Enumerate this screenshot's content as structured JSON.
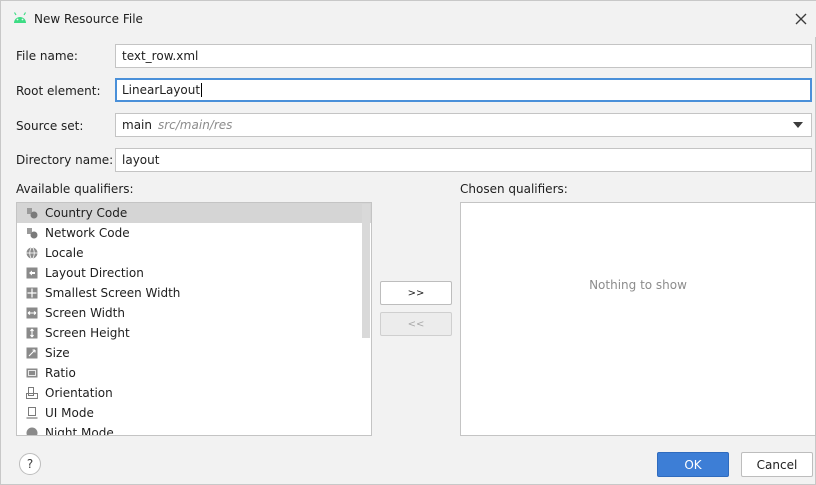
{
  "window": {
    "title": "New Resource File",
    "accent_color": "#3d7ed6",
    "android_icon_color": "#3ddc84"
  },
  "form": {
    "file_name_label": "File name:",
    "file_name_value": "text_row.xml",
    "root_element_label": "Root element:",
    "root_element_value": "LinearLayout",
    "source_set_label": "Source set:",
    "source_set_value": "main",
    "source_set_path": "src/main/res",
    "directory_name_label": "Directory name:",
    "directory_name_value": "layout"
  },
  "qualifiers": {
    "available_label": "Available qualifiers:",
    "chosen_label": "Chosen qualifiers:",
    "items": [
      {
        "label": "Country Code",
        "icon": "country-code-icon",
        "selected": true
      },
      {
        "label": "Network Code",
        "icon": "network-code-icon",
        "selected": false
      },
      {
        "label": "Locale",
        "icon": "globe-icon",
        "selected": false
      },
      {
        "label": "Layout Direction",
        "icon": "layout-direction-icon",
        "selected": false
      },
      {
        "label": "Smallest Screen Width",
        "icon": "smallest-width-icon",
        "selected": false
      },
      {
        "label": "Screen Width",
        "icon": "screen-width-icon",
        "selected": false
      },
      {
        "label": "Screen Height",
        "icon": "screen-height-icon",
        "selected": false
      },
      {
        "label": "Size",
        "icon": "size-icon",
        "selected": false
      },
      {
        "label": "Ratio",
        "icon": "ratio-icon",
        "selected": false
      },
      {
        "label": "Orientation",
        "icon": "orientation-icon",
        "selected": false
      },
      {
        "label": "UI Mode",
        "icon": "ui-mode-icon",
        "selected": false
      },
      {
        "label": "Night Mode",
        "icon": "night-mode-icon",
        "selected": false
      }
    ],
    "add_button": ">>",
    "remove_button": "<<",
    "empty_text": "Nothing to show"
  },
  "footer": {
    "help_label": "?",
    "ok_label": "OK",
    "cancel_label": "Cancel"
  }
}
